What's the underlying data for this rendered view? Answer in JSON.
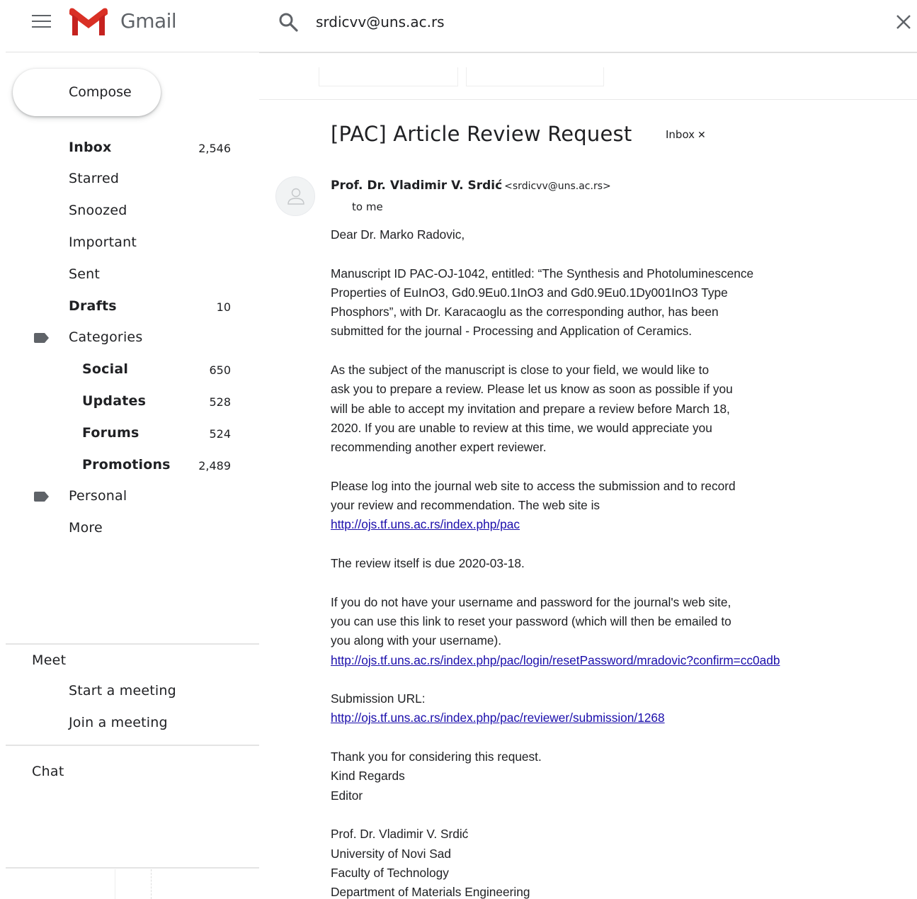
{
  "header": {
    "brand": "Gmail",
    "search_value": "srdicvv@uns.ac.rs"
  },
  "sidebar": {
    "compose": "Compose",
    "items": [
      {
        "label": "Inbox",
        "count": "2,546",
        "bold": true
      },
      {
        "label": "Starred",
        "count": ""
      },
      {
        "label": "Snoozed",
        "count": ""
      },
      {
        "label": "Important",
        "count": ""
      },
      {
        "label": "Sent",
        "count": ""
      },
      {
        "label": "Drafts",
        "count": "10",
        "bold": true
      },
      {
        "label": "Categories",
        "count": ""
      },
      {
        "label": "Social",
        "count": "650",
        "bold": true
      },
      {
        "label": "Updates",
        "count": "528",
        "bold": true
      },
      {
        "label": "Forums",
        "count": "524",
        "bold": true
      },
      {
        "label": "Promotions",
        "count": "2,489",
        "bold": true
      },
      {
        "label": "Personal",
        "count": ""
      },
      {
        "label": "More",
        "count": ""
      }
    ],
    "meet": {
      "title": "Meet",
      "start": "Start a meeting",
      "join": "Join a meeting"
    },
    "chat": {
      "title": "Chat"
    }
  },
  "email": {
    "subject": "[PAC] Article Review Request",
    "label_chip": "Inbox",
    "sender_name": "Prof. Dr. Vladimir V. Srdić",
    "sender_email": "<srdicvv@uns.ac.rs>",
    "to": "to me",
    "greeting": "Dear Dr. Marko Radovic,",
    "p1_l1": "Manuscript ID PAC-OJ-1042, entitled: “The Synthesis and Photoluminescence",
    "p1_l2": "Properties of EuInO3, Gd0.9Eu0.1InO3 and Gd0.9Eu0.1Dy001InO3 Type",
    "p1_l3": "Phosphors”, with Dr. Karacaoglu as the corresponding author, has been",
    "p1_l4": "submitted for the journal - Processing and Application of Ceramics.",
    "p2_l1": "As the subject of the manuscript is close to your field, we would like to",
    "p2_l2": "ask you to prepare a review. Please let us know as soon as possible if you",
    "p2_l3": "will be able to accept my invitation and prepare a review before March 18,",
    "p2_l4": "2020. If you are unable to review at this time, we would appreciate you",
    "p2_l5": "recommending another expert reviewer.",
    "p3_l1": "Please log into the journal web site to access the submission and to record",
    "p3_l2": "your review and recommendation. The web site is",
    "p3_link": "http://ojs.tf.uns.ac.rs/index.php/pac",
    "p4": "The review itself is due 2020-03-18.",
    "p5_l1": "If you do not have your username and password for the journal's web site,",
    "p5_l2": "you can use this link to reset your password (which will then be emailed to",
    "p5_l3": "you along with your username).",
    "p5_link": "http://ojs.tf.uns.ac.rs/index.php/pac/login/resetPassword/mradovic?confirm=cc0adb",
    "p6_l1": "Submission URL:",
    "p6_link": "http://ojs.tf.uns.ac.rs/index.php/pac/reviewer/submission/1268",
    "p7_l1": "Thank you for considering this request.",
    "p7_l2": "Kind Regards",
    "p7_l3": "Editor",
    "sig_l1": "Prof. Dr. Vladimir V. Srdić",
    "sig_l2": "University of Novi Sad",
    "sig_l3": "Faculty of Technology",
    "sig_l4": "Department of Materials Engineering"
  }
}
